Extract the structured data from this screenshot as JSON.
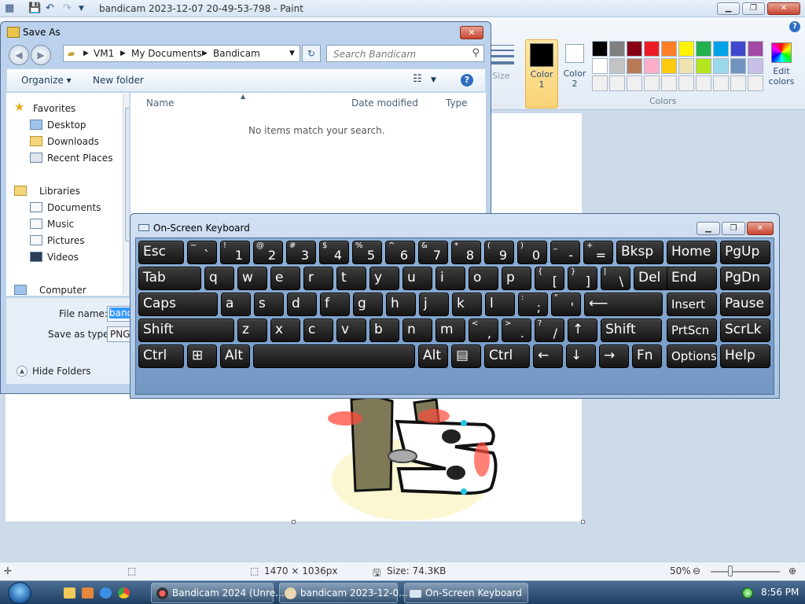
{
  "paint": {
    "title": "bandicam 2023-12-07 20-49-53-798 - Paint",
    "ribbon": {
      "size_label": "Size",
      "color1_label": "Color 1",
      "color2_label": "Color 2",
      "colors_group_label": "Colors",
      "edit_colors_label": "Edit colors",
      "color1": "#000000",
      "color2": "#ffffff",
      "palette": [
        "#000000",
        "#7f7f7f",
        "#880015",
        "#ed1c24",
        "#ff7f27",
        "#fff200",
        "#22b14c",
        "#00a2e8",
        "#3f48cc",
        "#a349a4",
        "#ffffff",
        "#c3c3c3",
        "#b97a57",
        "#ffaec9",
        "#ffc90e",
        "#efe4b0",
        "#b5e61d",
        "#99d9ea",
        "#7092be",
        "#c8bfe7",
        "#f0f0f0",
        "#f0f0f0",
        "#f0f0f0",
        "#f0f0f0",
        "#f0f0f0",
        "#f0f0f0",
        "#f0f0f0",
        "#f0f0f0",
        "#f0f0f0",
        "#f0f0f0"
      ]
    },
    "status": {
      "dimensions": "1470 × 1036px",
      "size": "Size: 74.3KB",
      "zoom": "50%"
    }
  },
  "save_as": {
    "title": "Save As",
    "address": [
      "VM1",
      "My Documents",
      "Bandicam"
    ],
    "search_placeholder": "Search Bandicam",
    "toolbar": {
      "organize": "Organize ▾",
      "new_folder": "New folder"
    },
    "nav": {
      "favorites": "Favorites",
      "desktop": "Desktop",
      "downloads": "Downloads",
      "recent_places": "Recent Places",
      "libraries": "Libraries",
      "documents": "Documents",
      "music": "Music",
      "pictures": "Pictures",
      "videos": "Videos",
      "computer": "Computer"
    },
    "columns": {
      "name": "Name",
      "date_modified": "Date modified",
      "type": "Type"
    },
    "empty_message": "No items match your search.",
    "file_name_label": "File name:",
    "file_name_value": "bandic",
    "save_type_label": "Save as type:",
    "save_type_value": "PNG",
    "hide_folders": "Hide Folders"
  },
  "osk": {
    "title": "On-Screen Keyboard",
    "rows": [
      [
        {
          "main": "Esc"
        },
        {
          "shift": "~",
          "base": "`"
        },
        {
          "shift": "!",
          "base": "1"
        },
        {
          "shift": "@",
          "base": "2"
        },
        {
          "shift": "#",
          "base": "3"
        },
        {
          "shift": "$",
          "base": "4"
        },
        {
          "shift": "%",
          "base": "5"
        },
        {
          "shift": "^",
          "base": "6"
        },
        {
          "shift": "&",
          "base": "7"
        },
        {
          "shift": "*",
          "base": "8"
        },
        {
          "shift": "(",
          "base": "9"
        },
        {
          "shift": ")",
          "base": "0"
        },
        {
          "shift": "_",
          "base": "-"
        },
        {
          "shift": "+",
          "base": "="
        },
        {
          "main": "Bksp"
        },
        {
          "main": "Home"
        },
        {
          "main": "PgUp"
        }
      ],
      [
        {
          "main": "Tab"
        },
        {
          "main": "q"
        },
        {
          "main": "w"
        },
        {
          "main": "e"
        },
        {
          "main": "r"
        },
        {
          "main": "t"
        },
        {
          "main": "y"
        },
        {
          "main": "u"
        },
        {
          "main": "i"
        },
        {
          "main": "o"
        },
        {
          "main": "p"
        },
        {
          "shift": "{",
          "base": "["
        },
        {
          "shift": "}",
          "base": "]"
        },
        {
          "shift": "|",
          "base": "\\"
        },
        {
          "main": "Del"
        },
        {
          "main": "End"
        },
        {
          "main": "PgDn"
        }
      ],
      [
        {
          "main": "Caps"
        },
        {
          "main": "a"
        },
        {
          "main": "s"
        },
        {
          "main": "d"
        },
        {
          "main": "f"
        },
        {
          "main": "g"
        },
        {
          "main": "h"
        },
        {
          "main": "j"
        },
        {
          "main": "k"
        },
        {
          "main": "l"
        },
        {
          "shift": ":",
          "base": ";"
        },
        {
          "shift": "\"",
          "base": "'"
        },
        {
          "main": "⟵"
        },
        {
          "main": "Insert"
        },
        {
          "main": "Pause"
        }
      ],
      [
        {
          "main": "Shift"
        },
        {
          "main": "z"
        },
        {
          "main": "x"
        },
        {
          "main": "c"
        },
        {
          "main": "v"
        },
        {
          "main": "b"
        },
        {
          "main": "n"
        },
        {
          "main": "m"
        },
        {
          "shift": "<",
          "base": ","
        },
        {
          "shift": ">",
          "base": "."
        },
        {
          "shift": "?",
          "base": "/"
        },
        {
          "main": "↑"
        },
        {
          "main": "Shift"
        },
        {
          "main": "PrtScn"
        },
        {
          "main": "ScrLk"
        }
      ],
      [
        {
          "main": "Ctrl"
        },
        {
          "main": "⊞"
        },
        {
          "main": "Alt"
        },
        {
          "main": ""
        },
        {
          "main": "Alt"
        },
        {
          "main": "▤"
        },
        {
          "main": "Ctrl"
        },
        {
          "main": "←"
        },
        {
          "main": "↓"
        },
        {
          "main": "→"
        },
        {
          "main": "Fn"
        },
        {
          "main": "Options"
        },
        {
          "main": "Help"
        }
      ]
    ]
  },
  "taskbar": {
    "tasks": [
      "Bandicam 2024 (Unre...",
      "bandicam 2023-12-0...",
      "On-Screen Keyboard"
    ],
    "clock": "8:56 PM"
  }
}
